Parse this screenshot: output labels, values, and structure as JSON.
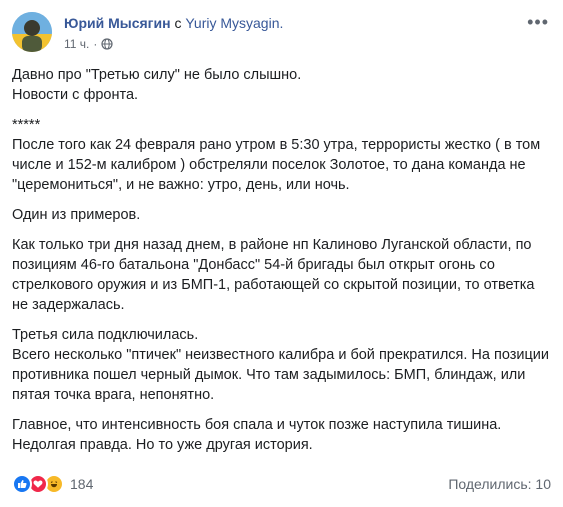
{
  "post": {
    "author_name": "Юрий Мысягин",
    "with_word": "с",
    "page_name": "Yuriy Mysyagin.",
    "time": "11 ч.",
    "paragraphs": [
      "Давно про \"Третью силу\" не было слышно.\nНовости с фронта.",
      "*****\nПосле того как 24 февраля рано утром в 5:30 утра, террористы жестко ( в том числе и 152-м калибром ) обстреляли поселок Золотое, то дана команда не \"церемониться\", и не важно: утро, день, или ночь.",
      "Один из примеров.",
      "Как только три дня назад днем, в районе нп Калиново Луганской области, по позициям 46-го батальона \"Донбасс\" 54-й бригады был открыт огонь со стрелкового оружия и из БМП-1, работающей со скрытой позиции, то ответка не задержалась.",
      "Третья сила подключилась.\nВсего несколько \"птичек\" неизвестного калибра и бой прекратился. На позиции противника пошел черный дымок. Что там задымилось: БМП, блиндаж, или пятая точка врага, непонятно.",
      "Главное, что интенсивность боя спала и чуток позже наступила тишина. Недолгая правда. Но то уже другая история."
    ],
    "reactions_count": "184",
    "shares_text": "Поделились: 10"
  },
  "icons": {
    "privacy": "globe-icon",
    "menu": "more-options-icon",
    "reactions": [
      "like-icon",
      "love-icon",
      "haha-icon"
    ]
  },
  "colors": {
    "link": "#385898",
    "secondary_text": "#606770",
    "like": "#1877f2",
    "love": "#f0284a",
    "haha": "#f7b928"
  }
}
